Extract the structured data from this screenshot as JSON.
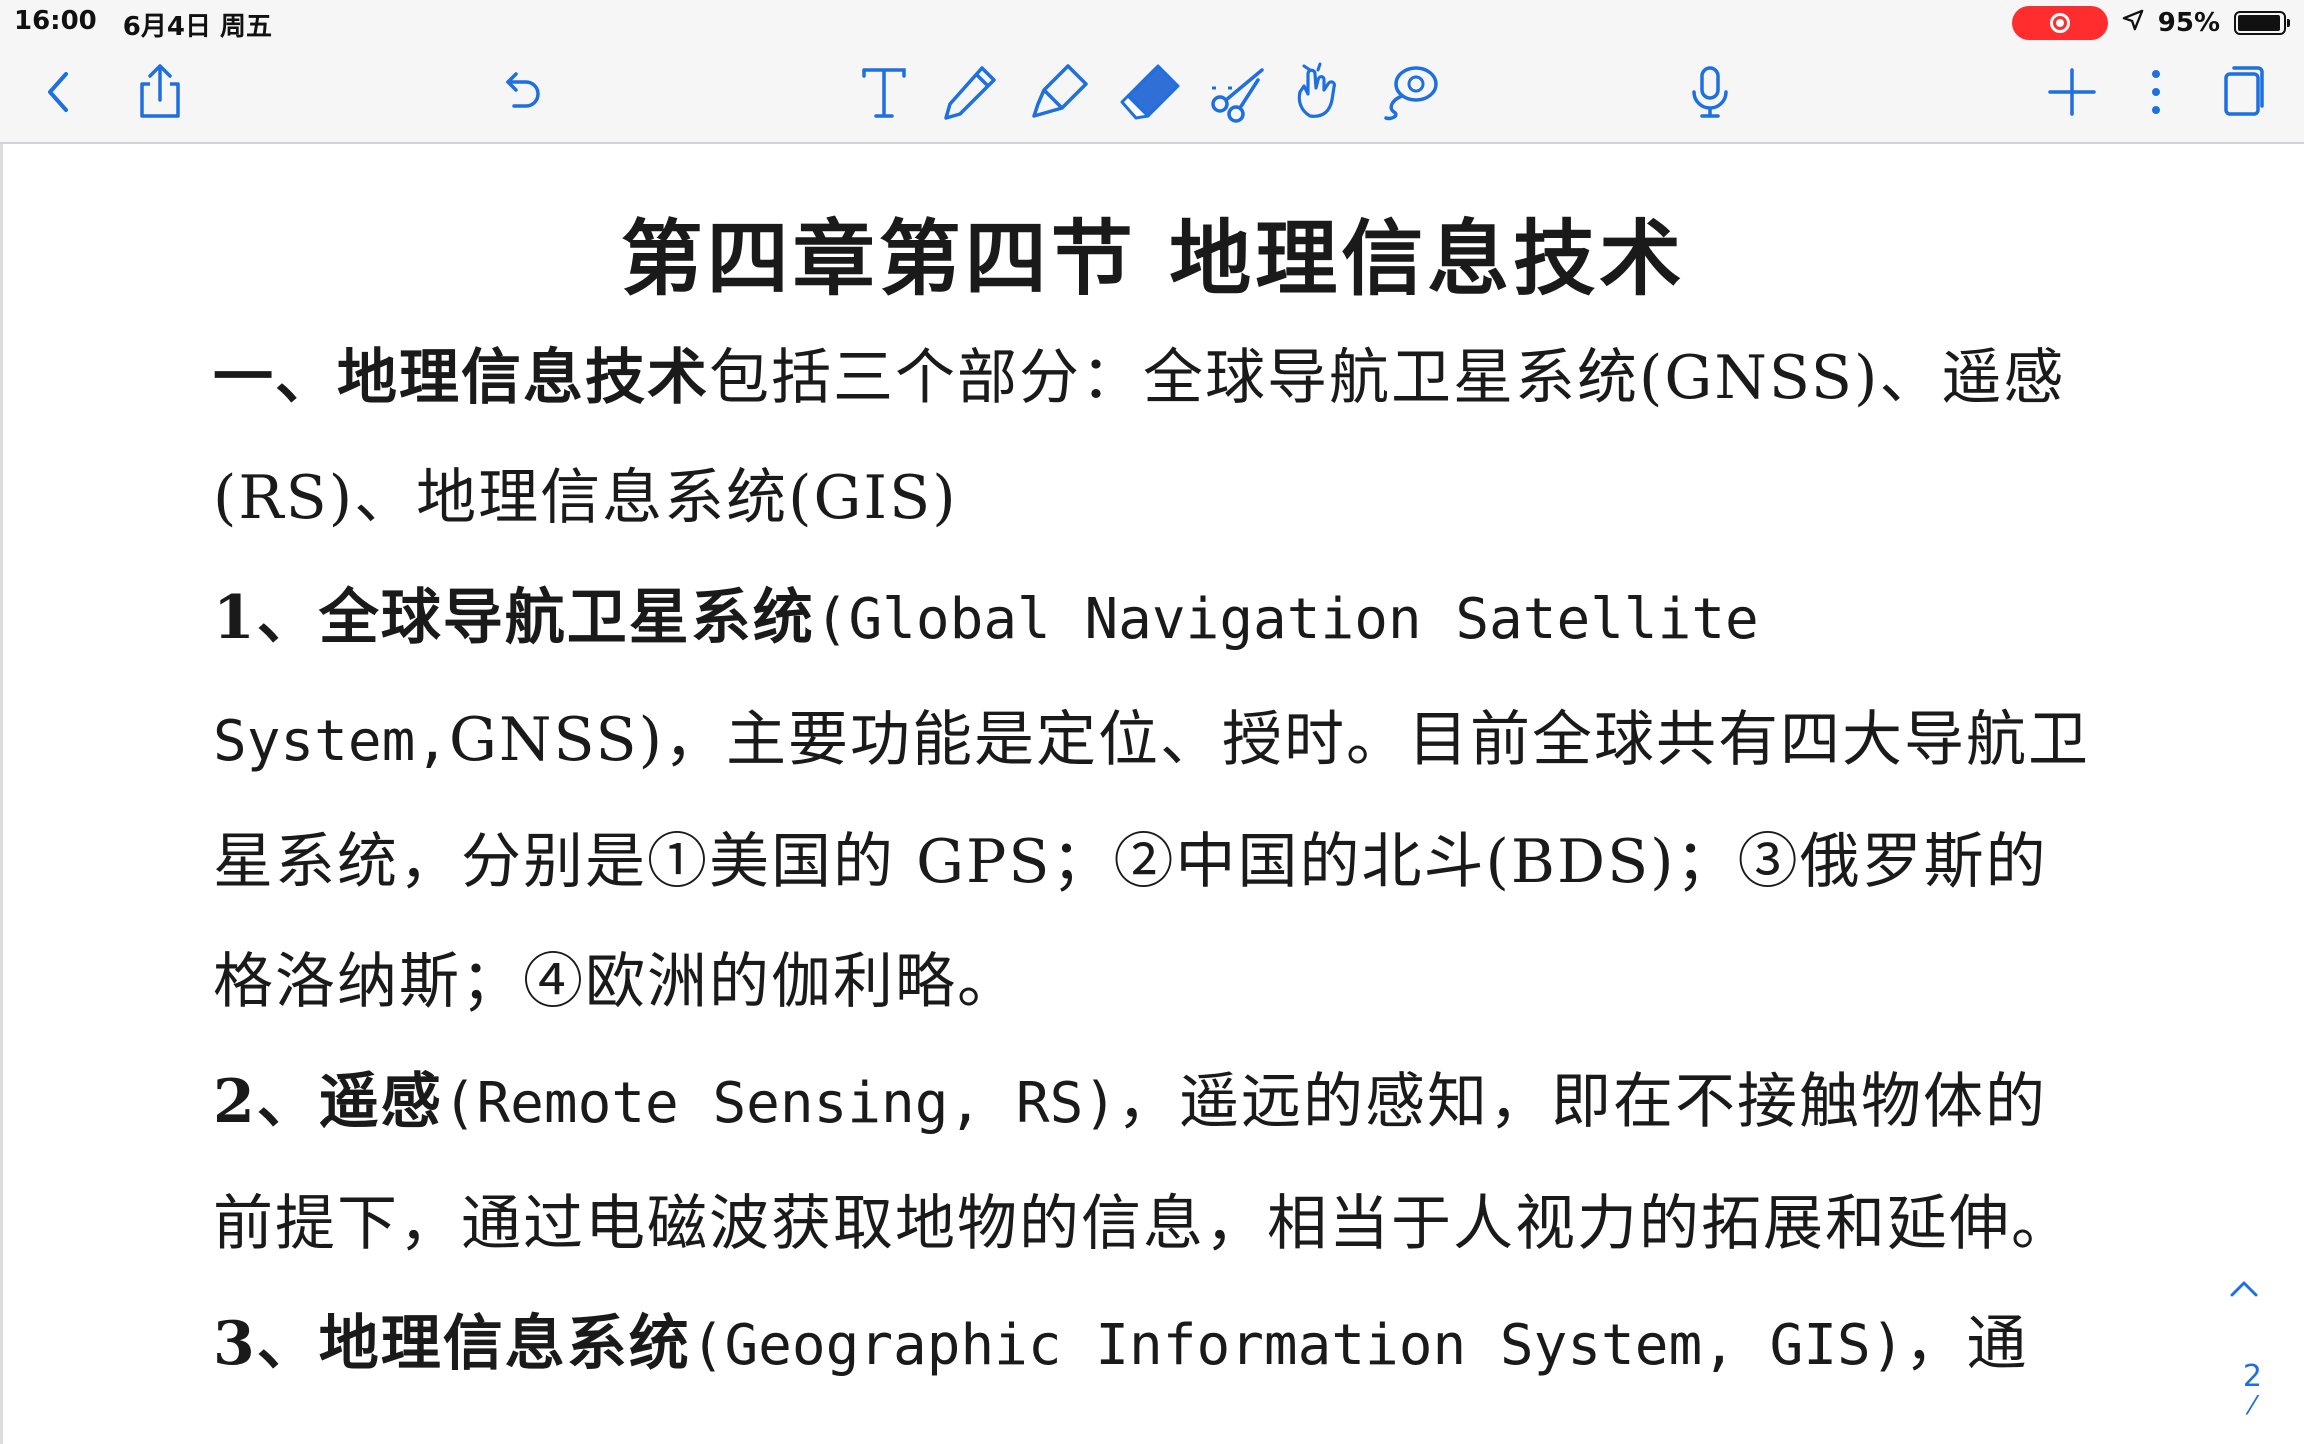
{
  "status_bar": {
    "time": "16:00",
    "date": "6月4日 周五",
    "battery_percent": "95%",
    "battery_level": 0.95
  },
  "toolbar": {
    "icons": [
      "back-chevron-icon",
      "share-icon",
      "undo-icon",
      "text-tool-icon",
      "pen-tool-icon",
      "highlighter-tool-icon",
      "eraser-tool-icon",
      "lasso-scissors-icon",
      "hand-pointer-icon",
      "lasso-tool-icon",
      "microphone-icon",
      "add-icon",
      "more-icon",
      "pages-icon"
    ],
    "accent_color": "#1e6fe0",
    "eraser_fill": "#2f6fd6"
  },
  "document": {
    "title": "第四章第四节  地理信息技术",
    "p1_bold": "一、地理信息技术",
    "p1_text": "包括三个部分：全球导航卫星系统(GNSS)、遥感(RS)、地理信息系统(GIS)",
    "p2_bold": "1、全球导航卫星系统",
    "p2_latin": "(Global Navigation Satellite System,",
    "p2_text": "GNSS)，主要功能是定位、授时。目前全球共有四大导航卫星系统，分别是①美国的 GPS；②中国的北斗(BDS)；③俄罗斯的格洛纳斯；④欧洲的伽利略。",
    "p3_bold": "2、遥感",
    "p3_latin": "(Remote Sensing, RS)",
    "p3_text": "，遥远的感知，即在不接触物体的前提下，通过电磁波获取地物的信息，相当于人视力的拓展和延伸。",
    "p4_bold": "3、地理信息系统",
    "p4_latin": "(Geographic Information System, GIS)",
    "p4_text": "，通"
  },
  "sidebar": {
    "page_number": "2"
  }
}
